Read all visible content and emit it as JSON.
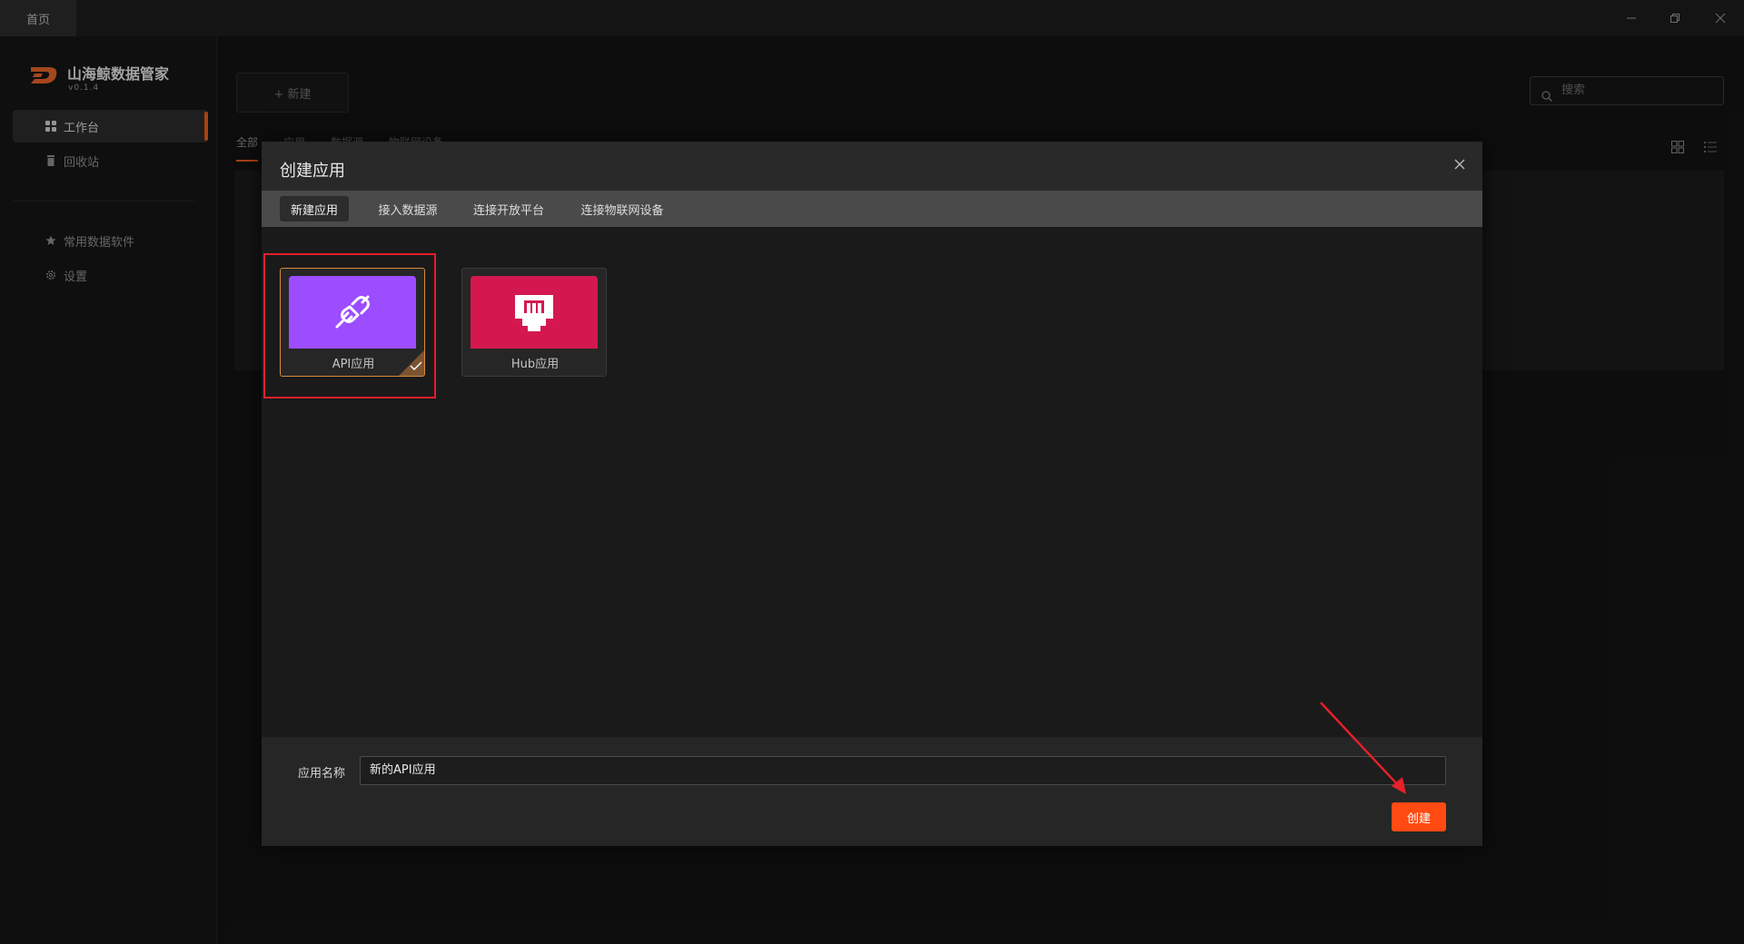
{
  "window": {
    "tab_home": "首页"
  },
  "sidebar": {
    "app_name": "山海鲸数据管家",
    "version": "v0.1.4",
    "items": [
      {
        "label": "工作台",
        "icon": "grid-icon",
        "active": true
      },
      {
        "label": "回收站",
        "icon": "trash-icon",
        "active": false
      },
      {
        "label": "常用数据软件",
        "icon": "star-icon",
        "active": false
      },
      {
        "label": "设置",
        "icon": "gear-icon",
        "active": false
      }
    ]
  },
  "main": {
    "new_button": "+ 新建",
    "search_placeholder": "搜索",
    "filter_tabs": [
      "全部",
      "应用",
      "数据源",
      "物联网设备"
    ]
  },
  "modal": {
    "title": "创建应用",
    "tabs": [
      "新建应用",
      "接入数据源",
      "连接开放平台",
      "连接物联网设备"
    ],
    "active_tab": 0,
    "cards": [
      {
        "label": "API应用",
        "icon": "plug-icon",
        "color": "#9b4dff",
        "selected": true
      },
      {
        "label": "Hub应用",
        "icon": "hub-icon",
        "color": "#d4184f",
        "selected": false
      }
    ],
    "name_label": "应用名称",
    "name_value": "新的API应用",
    "create_button": "创建"
  },
  "colors": {
    "accent": "#e85a1c",
    "create": "#ff4b12",
    "highlight": "#e0202a"
  }
}
